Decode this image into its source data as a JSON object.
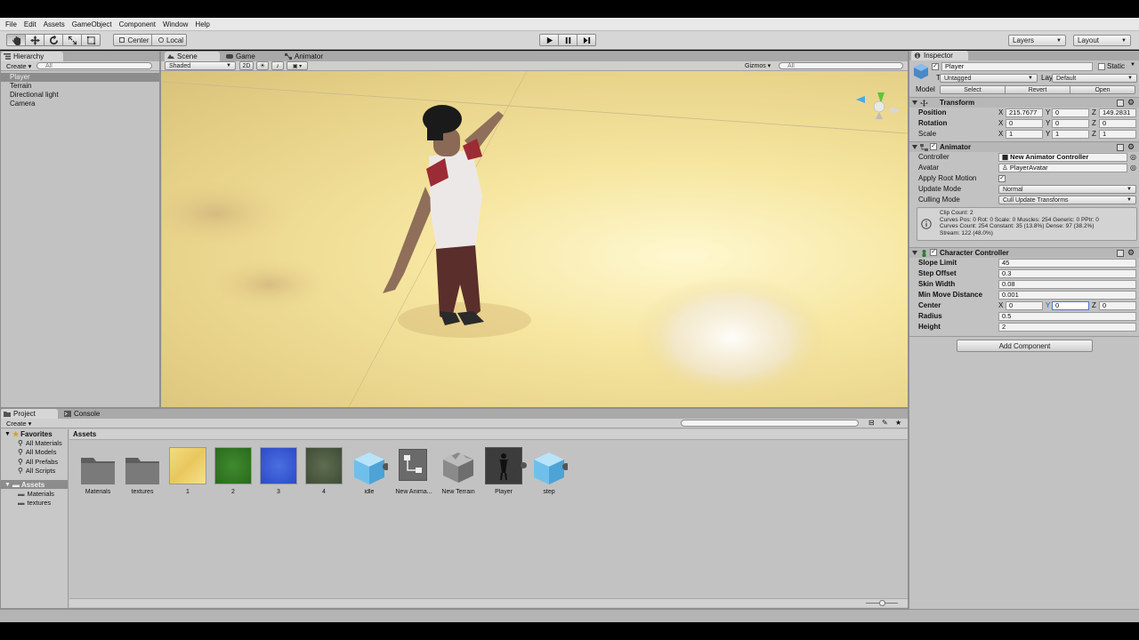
{
  "menu": [
    "File",
    "Edit",
    "Assets",
    "GameObject",
    "Component",
    "Window",
    "Help"
  ],
  "toolbar": {
    "pivot_center": "Center",
    "pivot_local": "Local",
    "layers_label": "Layers",
    "layout_label": "Layout"
  },
  "hierarchy": {
    "tab": "Hierarchy",
    "create": "Create",
    "search_placeholder": "All",
    "items": [
      "Player",
      "Terrain",
      "Directional light",
      "Camera"
    ]
  },
  "scene": {
    "tabs": [
      "Scene",
      "Game",
      "Animator"
    ],
    "shading": "Shaded",
    "mode_2d": "2D",
    "gizmos": "Gizmos",
    "search_placeholder": "All"
  },
  "inspector": {
    "tab": "Inspector",
    "object_name": "Player",
    "static_label": "Static",
    "tag_label": "Tag",
    "tag_value": "Untagged",
    "layer_label": "Layer",
    "layer_value": "Default",
    "model_label": "Model",
    "model_buttons": [
      "Select",
      "Revert",
      "Open"
    ],
    "transform": {
      "title": "Transform",
      "position_label": "Position",
      "rotation_label": "Rotation",
      "scale_label": "Scale",
      "axes": [
        "X",
        "Y",
        "Z"
      ],
      "position": [
        "215.7677",
        "0",
        "149.2831"
      ],
      "rotation": [
        "0",
        "0",
        "0"
      ],
      "scale": [
        "1",
        "1",
        "1"
      ]
    },
    "animator": {
      "title": "Animator",
      "controller_label": "Controller",
      "controller_value": "New Animator Controller",
      "avatar_label": "Avatar",
      "avatar_value": "PlayerAvatar",
      "apply_root_motion_label": "Apply Root Motion",
      "update_mode_label": "Update Mode",
      "update_mode_value": "Normal",
      "culling_mode_label": "Culling Mode",
      "culling_mode_value": "Cull Update Transforms",
      "info_lines": [
        "Clip Count: 2",
        "Curves Pos: 0 Rot: 0 Scale: 0 Muscles: 254 Generic: 0 PPtr: 0",
        "Curves Count: 254 Constant: 35 (13.8%) Dense: 97 (38.2%)",
        "Stream: 122 (48.0%)"
      ]
    },
    "character_controller": {
      "title": "Character Controller",
      "slope_limit_label": "Slope Limit",
      "slope_limit": "45",
      "step_offset_label": "Step Offset",
      "step_offset": "0.3",
      "skin_width_label": "Skin Width",
      "skin_width": "0.08",
      "min_move_label": "Min Move Distance",
      "min_move": "0.001",
      "center_label": "Center",
      "center": [
        "0",
        "0",
        "0"
      ],
      "radius_label": "Radius",
      "radius": "0.5",
      "height_label": "Height",
      "height": "2"
    },
    "add_component": "Add Component"
  },
  "project": {
    "tabs": [
      "Project",
      "Console"
    ],
    "create": "Create",
    "favorites_label": "Favorites",
    "favorites": [
      "All Materials",
      "All Models",
      "All Prefabs",
      "All Scripts"
    ],
    "assets_label": "Assets",
    "asset_folders": [
      "Materials",
      "textures"
    ],
    "breadcrumb": "Assets",
    "items": [
      {
        "label": "Materials",
        "icon": "folder-icon"
      },
      {
        "label": "textures",
        "icon": "folder-icon"
      },
      {
        "label": "1",
        "icon": "sand-texture-icon"
      },
      {
        "label": "2",
        "icon": "grass-texture-icon"
      },
      {
        "label": "3",
        "icon": "water-texture-icon"
      },
      {
        "label": "4",
        "icon": "rock-texture-icon"
      },
      {
        "label": "idle",
        "icon": "prefab-cube-icon"
      },
      {
        "label": "New Anima...",
        "icon": "animator-controller-icon"
      },
      {
        "label": "New Terrain",
        "icon": "terrain-icon"
      },
      {
        "label": "Player",
        "icon": "model-icon"
      },
      {
        "label": "step",
        "icon": "prefab-cube-icon"
      }
    ]
  },
  "colors": {
    "panel": "#c2c2c2",
    "selection": "#8c8c8c",
    "terrain_sand": "#f6e6a0"
  }
}
